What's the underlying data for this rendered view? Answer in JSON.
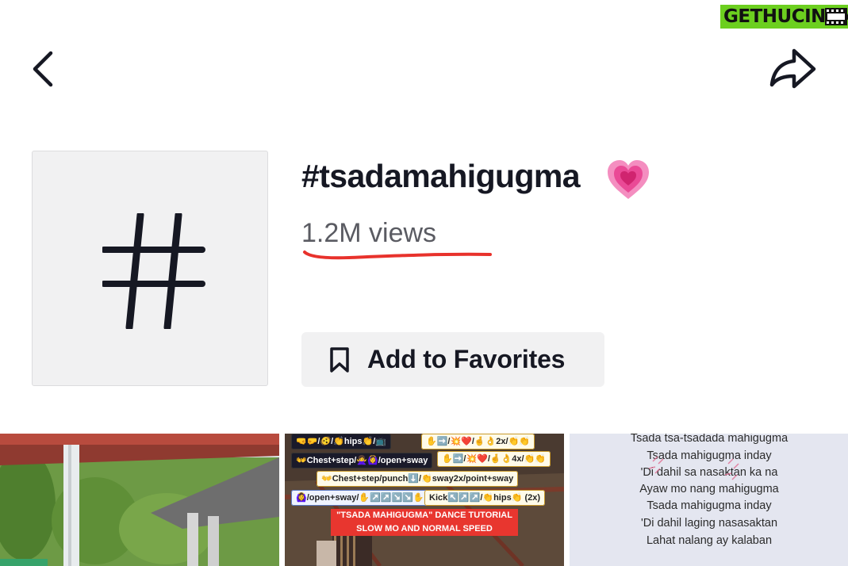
{
  "watermark": {
    "text": "GETHUCINEMA",
    "icon": "film-reel-icon"
  },
  "header": {
    "back_icon": "chevron-left-icon",
    "share_icon": "share-arrow-icon"
  },
  "hashtag": {
    "tile_icon": "hashtag-icon",
    "title": "#tsadamahigugma",
    "title_emoji": "💗",
    "views": "1.2M views",
    "underline_color": "#e8322c"
  },
  "favorites": {
    "icon": "bookmark-icon",
    "label": "Add to Favorites"
  },
  "thumbnails": [
    {
      "kind": "outdoor-covered-court-photo"
    },
    {
      "kind": "dance-tutorial",
      "tags": [
        "🤜🤛/🫨/👏hips👏/📺",
        "✋➡️/💥❤️/🤞👌2x/👏👏",
        "👐Chest+step/🙅‍♀️🙆‍♀️/open+sway",
        "✋➡️/💥❤️/🤞👌4x/👏👏",
        "👐Chest+step/punch⬇️/👏sway2x/point+sway",
        "🙆‍♀️/open+sway/✋↗️↗️↘️↘️✋",
        "Kick↖️↗️↗️/👏hips👏 (2x)"
      ],
      "caption_1": "\"TSADA MAHIGUGMA\" DANCE TUTORIAL",
      "caption_2": "SLOW MO AND NORMAL SPEED"
    },
    {
      "kind": "lyrics",
      "lines": [
        "Tsada tsa-tsadada mahigugma",
        "Tsada mahigugma inday",
        "'Di dahil sa nasaktan ka na",
        "Ayaw mo nang mahigugma",
        "Tsada mahigugma inday",
        "'Di dahil laging nasasaktan",
        "Lahat nalang ay kalaban"
      ]
    }
  ]
}
